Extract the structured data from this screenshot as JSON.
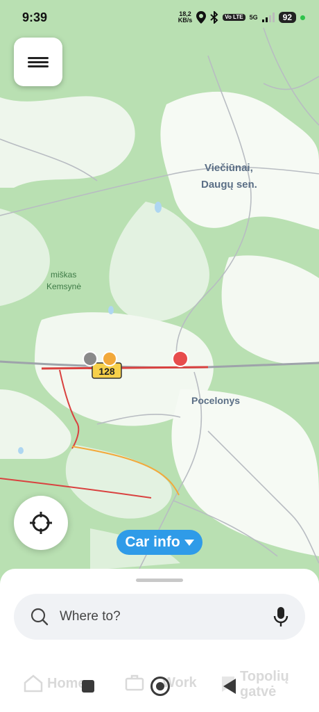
{
  "status_bar": {
    "time": "9:39",
    "speed_value": "18,2",
    "speed_unit": "KB/s",
    "volte": "Vo LTE",
    "network": "5G",
    "battery": "92"
  },
  "map": {
    "places": [
      {
        "name": "Viečiūnai,"
      },
      {
        "name": "Daugų sen."
      },
      {
        "name": "miškas"
      },
      {
        "name": "Kemsynė"
      },
      {
        "name": "Pocelonys"
      }
    ],
    "road_badge": "128"
  },
  "car_info_label": "Car info",
  "search": {
    "placeholder": "Where to?"
  },
  "tabs": {
    "home": "Home",
    "work": "Work",
    "recent": "Topolių gatvė"
  },
  "colors": {
    "accent": "#2f9be8",
    "forest": "#b9e0b2",
    "traffic_red": "#d9413f",
    "marker_red": "#e74c4c",
    "marker_orange": "#f2a93b",
    "marker_grey": "#8a8a8a",
    "road_badge_bg": "#f7d04a"
  }
}
